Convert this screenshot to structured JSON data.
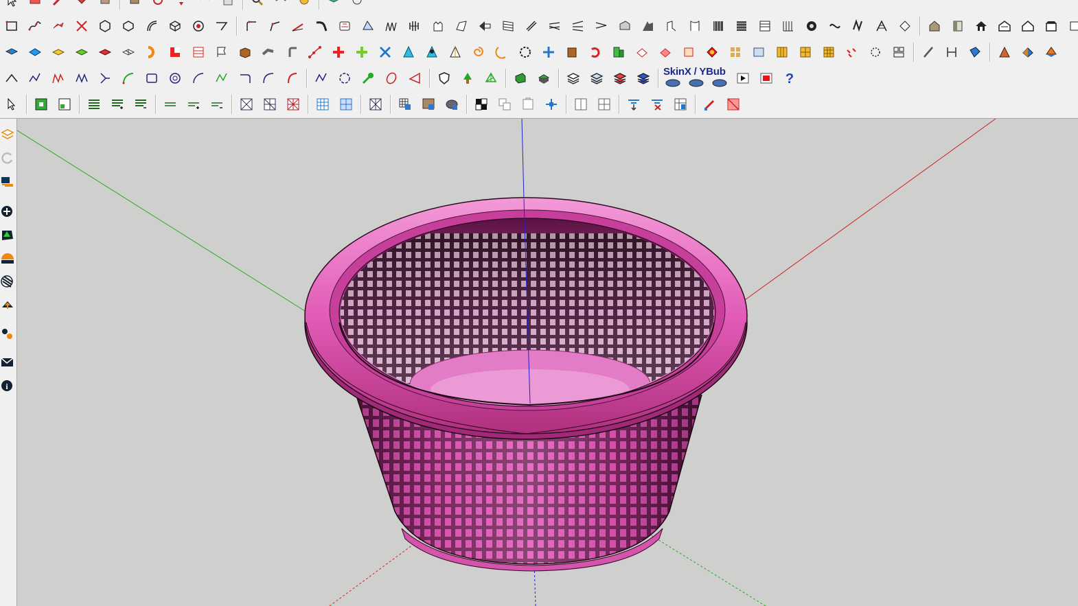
{
  "window": {
    "app": "SketchUp"
  },
  "colors": {
    "toolbar_bg": "#f0f0f0",
    "viewport_bg": "#cfcfcd",
    "axis_red": "#cc2222",
    "axis_green": "#22aa22",
    "axis_blue": "#2222cc",
    "model_fill": "#e060b8",
    "model_shadow": "#8a2468",
    "model_highlight": "#f6a0dc"
  },
  "toolbars": {
    "row0": [
      "select-icon",
      "eraser-icon",
      "pencil-icon",
      "paint-bucket-icon",
      "tape-measure-icon",
      "push-pull-icon",
      "rotate-icon",
      "move-icon",
      "offset-icon",
      "zoom-icon",
      "orbit-icon",
      "pan-icon",
      "layers-icon",
      "walk-icon",
      "save-icon"
    ],
    "row1": [
      "rectangle-icon",
      "freehand-icon",
      "dimension-icon",
      "protractor-icon",
      "arc-icon",
      "circle-icon",
      "polygon-icon",
      "follow-me-icon",
      "intersect-icon",
      "trim-icon",
      "extend-icon",
      "fillet-icon",
      "chamfer-icon",
      "curve-icon",
      "loft-icon",
      "bezier-icon",
      "grid-icon",
      "stairs-icon",
      "roof-icon",
      "window-icon",
      "door-icon",
      "wall-icon",
      "house-icon"
    ],
    "row2": [
      "box-icon",
      "plane-icon",
      "sandbox-icon",
      "terrain-icon",
      "flip-icon",
      "array-icon",
      "scale-icon",
      "split-icon",
      "weld-icon",
      "explode-icon",
      "cone-icon",
      "sphere-icon",
      "torus-icon",
      "cube-icon",
      "mirror-icon",
      "pipe-icon",
      "twist-icon",
      "bend-icon",
      "subdivide-icon",
      "smooth-icon",
      "crease-icon",
      "texture-icon",
      "uv-icon",
      "material-icon"
    ],
    "row3": [
      "line-icon",
      "spline-icon",
      "nurbs-icon",
      "polyline-icon",
      "arc3pt-icon",
      "rectangle2-icon",
      "circle2-icon",
      "arc2-icon",
      "zigzag-icon",
      "hook-icon",
      "curve2-icon",
      "shell-icon",
      "extrude-icon",
      "tree-icon",
      "layer-stack-icon",
      "book-icon",
      "component-icon"
    ],
    "skinx": {
      "label": "SkinX / YBub",
      "buttons": [
        "skin-icon-1",
        "skin-icon-2",
        "skin-icon-3",
        "play-icon",
        "stop-icon",
        "help-icon"
      ]
    },
    "row4": [
      "select-arrow-icon",
      "scale-up-icon",
      "scale-down-icon",
      "align-left-icon",
      "align-center-icon",
      "align-right-icon",
      "divide-h-icon",
      "divide-plus-icon",
      "divide-minus-icon",
      "cell-x-icon",
      "cell-grid-icon",
      "cell-cross-icon",
      "table-icon",
      "split-cell-icon",
      "merge-icon",
      "texture-blue-icon",
      "texture-brown-icon",
      "texture-dark-icon",
      "checker-icon",
      "copy-icon",
      "paste-icon",
      "move-arrows-icon",
      "grid-plus-icon",
      "grid-minus-icon",
      "arrow-down-icon",
      "delete-x-icon",
      "shade-icon",
      "pencil-red-icon",
      "eraser-pink-icon"
    ]
  },
  "left_bar": [
    "layers-icon",
    "refresh-icon",
    "camera-icon",
    "plus-circle-icon",
    "tree-icon",
    "sun-icon",
    "checker-icon",
    "cloud-icon",
    "gears-icon",
    "mail-icon",
    "info-icon"
  ],
  "model": {
    "name": "basket",
    "description": "Pink mesh laundry basket with rolled rim"
  }
}
